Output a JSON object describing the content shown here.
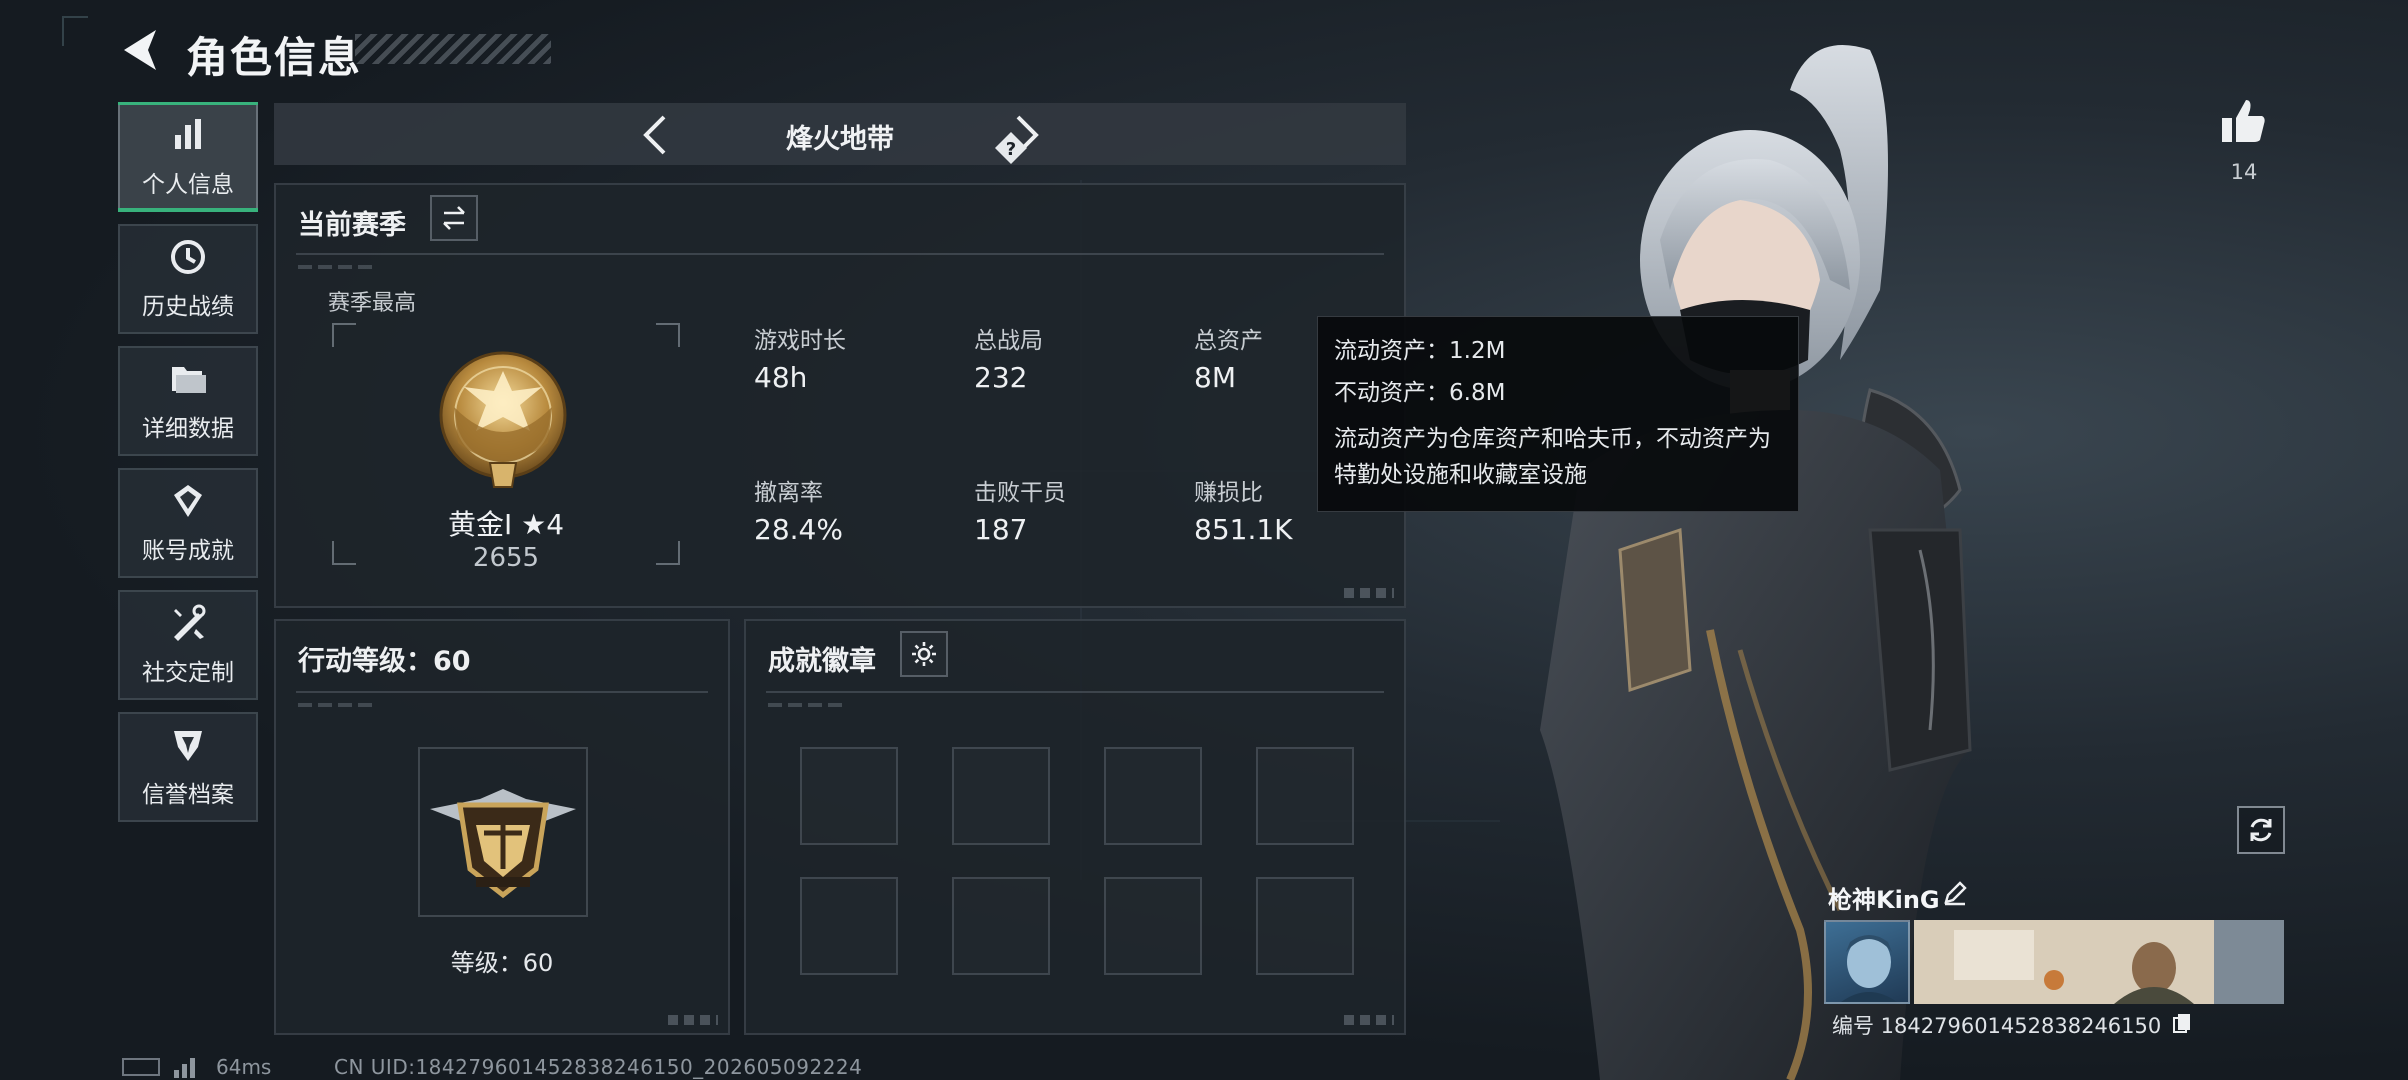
{
  "header": {
    "title": "角色信息"
  },
  "sidebar": {
    "items": [
      {
        "label": "个人信息",
        "icon": "bar-chart-icon",
        "active": true
      },
      {
        "label": "历史战绩",
        "icon": "clock-icon"
      },
      {
        "label": "详细数据",
        "icon": "folder-icon"
      },
      {
        "label": "账号成就",
        "icon": "achievement-icon"
      },
      {
        "label": "社交定制",
        "icon": "tools-icon"
      },
      {
        "label": "信誉档案",
        "icon": "credit-shield-icon"
      }
    ]
  },
  "mode": {
    "label": "烽火地带"
  },
  "season": {
    "title": "当前赛季",
    "best_label": "赛季最高",
    "rank_name": "黄金I ★4",
    "rank_score": "2655",
    "stats": [
      {
        "label": "游戏时长",
        "value": "48h"
      },
      {
        "label": "总战局",
        "value": "232"
      },
      {
        "label": "总资产",
        "value": "8M"
      },
      {
        "label": "撤离率",
        "value": "28.4%"
      },
      {
        "label": "击败干员",
        "value": "187"
      },
      {
        "label": "赚损比",
        "value": "851.1K"
      }
    ]
  },
  "tooltip": {
    "liquid": "流动资产：1.2M",
    "fixed": "不动资产：6.8M",
    "desc": "流动资产为仓库资产和哈夫币，不动资产为特勤处设施和收藏室设施"
  },
  "level": {
    "title": "行动等级：60",
    "text": "等级：60"
  },
  "achievements": {
    "title": "成就徽章"
  },
  "like": {
    "count": "14"
  },
  "player": {
    "name": "枪神KinG",
    "id_line": "编号 1842796014528382461​50"
  },
  "footer": {
    "ping": "64ms",
    "uid": "CN UID:1842796014528382461​50_202605092224"
  },
  "colors": {
    "accent": "#38b27c",
    "gold": "#c9a45a"
  }
}
